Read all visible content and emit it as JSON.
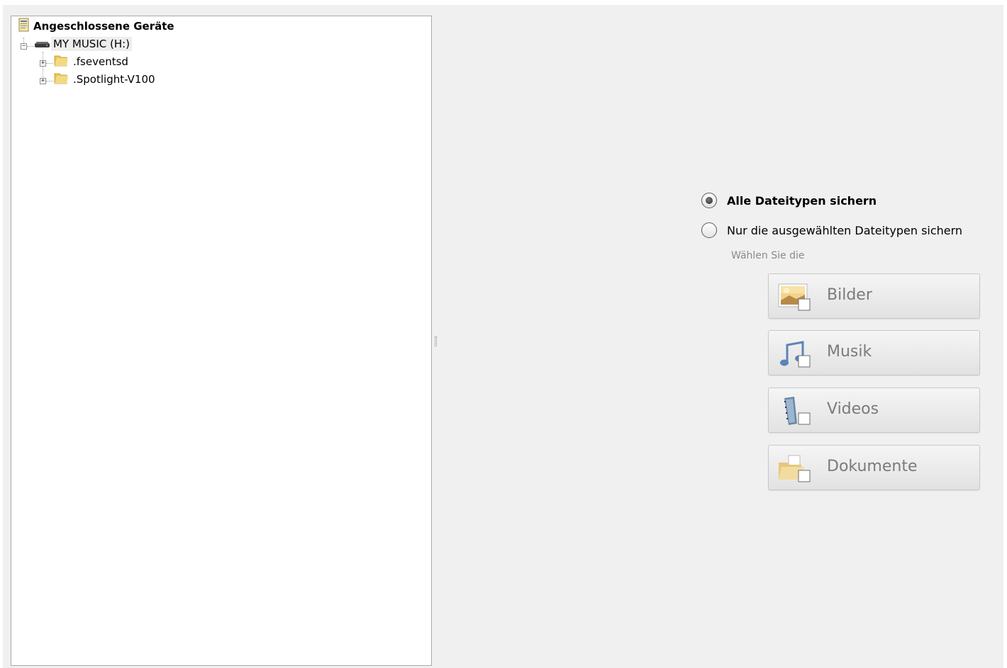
{
  "tree": {
    "root_label": "Angeschlossene Geräte",
    "drive_label": "MY MUSIC (H:)",
    "folders": [
      {
        "label": ".fseventsd"
      },
      {
        "label": ".Spotlight-V100"
      }
    ]
  },
  "options": {
    "all_types_label": "Alle Dateitypen sichern",
    "selected_types_label": "Nur die ausgewählten Dateitypen sichern",
    "selected": "all",
    "hint": "Wählen Sie die",
    "types": [
      {
        "label": "Bilder",
        "icon": "image-icon"
      },
      {
        "label": "Musik",
        "icon": "music-note-icon"
      },
      {
        "label": "Videos",
        "icon": "film-icon"
      },
      {
        "label": "Dokumente",
        "icon": "document-folder-icon"
      }
    ]
  }
}
